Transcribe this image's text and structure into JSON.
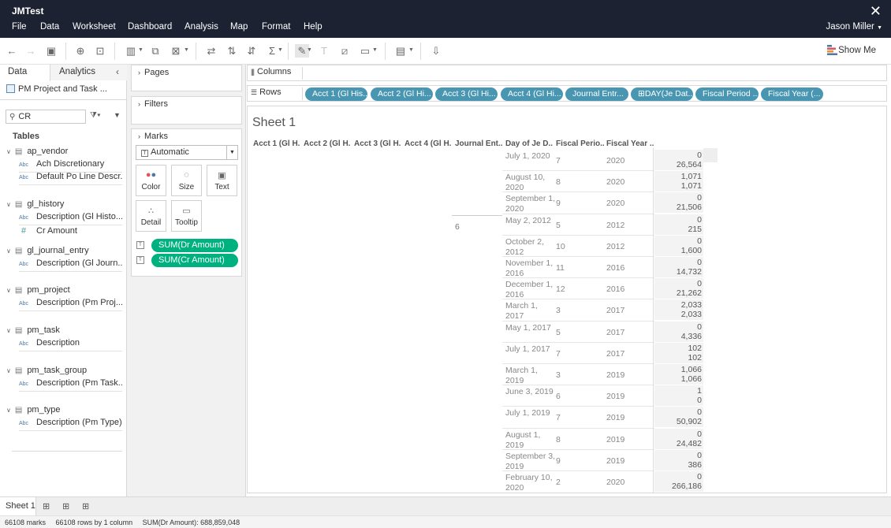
{
  "app": {
    "title": "JMTest",
    "user": "Jason Miller"
  },
  "menu": [
    "File",
    "Data",
    "Worksheet",
    "Dashboard",
    "Analysis",
    "Map",
    "Format",
    "Help"
  ],
  "toolbar": {
    "show_me": "Show Me"
  },
  "data_pane": {
    "tab_data": "Data",
    "tab_analytics": "Analytics",
    "datasource": "PM Project and Task ...",
    "search_value": "CR",
    "tables_header": "Tables",
    "tables": [
      {
        "name": "ap_vendor",
        "fields": [
          {
            "type": "Abc",
            "name": "Ach Discretionary"
          },
          {
            "type": "Abc",
            "name": "Default Po Line Descr..."
          }
        ]
      },
      {
        "name": "gl_history",
        "fields": [
          {
            "type": "Abc",
            "name": "Description (Gl Histo..."
          },
          {
            "type": "#",
            "name": "Cr Amount"
          }
        ]
      },
      {
        "name": "gl_journal_entry",
        "fields": [
          {
            "type": "Abc",
            "name": "Description (Gl Journ..."
          }
        ]
      },
      {
        "name": "pm_project",
        "fields": [
          {
            "type": "Abc",
            "name": "Description (Pm Proj..."
          }
        ]
      },
      {
        "name": "pm_task",
        "fields": [
          {
            "type": "Abc",
            "name": "Description"
          }
        ]
      },
      {
        "name": "pm_task_group",
        "fields": [
          {
            "type": "Abc",
            "name": "Description (Pm Task..."
          }
        ]
      },
      {
        "name": "pm_type",
        "fields": [
          {
            "type": "Abc",
            "name": "Description (Pm Type)"
          }
        ]
      }
    ]
  },
  "cards": {
    "pages": "Pages",
    "filters": "Filters",
    "marks": "Marks",
    "mark_type": "Automatic",
    "mark_buttons": [
      "Color",
      "Size",
      "Text",
      "Detail",
      "Tooltip"
    ],
    "mark_pills": [
      "SUM(Dr Amount)",
      "SUM(Cr Amount)"
    ]
  },
  "shelves": {
    "columns_label": "Columns",
    "rows_label": "Rows",
    "row_pills": [
      "Acct 1 (Gl His...",
      "Acct 2 (Gl Hi...",
      "Acct 3 (Gl Hi...",
      "Acct 4 (Gl Hi...",
      "Journal Entr...",
      "DAY(Je Dat...",
      "Fiscal Period ...",
      "Fiscal Year (..."
    ]
  },
  "sheet": {
    "title": "Sheet 1",
    "headers": [
      "Acct 1 (Gl H..",
      "Acct 2 (Gl H..",
      "Acct 3 (Gl H..",
      "Acct 4 (Gl H..",
      "Journal Ent..",
      "Day of Je D..",
      "Fiscal Perio..",
      "Fiscal Year .."
    ],
    "journal_entry": "6",
    "rows": [
      {
        "date": "July 1, 2020",
        "period": "7",
        "year": "2020",
        "dr": "0",
        "cr": "26,564"
      },
      {
        "date": "August 10, 2020",
        "period": "8",
        "year": "2020",
        "dr": "1,071",
        "cr": "1,071"
      },
      {
        "date": "September 1, 2020",
        "period": "9",
        "year": "2020",
        "dr": "0",
        "cr": "21,506"
      },
      {
        "date": "May 2, 2012",
        "period": "5",
        "year": "2012",
        "dr": "0",
        "cr": "215"
      },
      {
        "date": "October 2, 2012",
        "period": "10",
        "year": "2012",
        "dr": "0",
        "cr": "1,600"
      },
      {
        "date": "November 1, 2016",
        "period": "11",
        "year": "2016",
        "dr": "0",
        "cr": "14,732"
      },
      {
        "date": "December 1, 2016",
        "period": "12",
        "year": "2016",
        "dr": "0",
        "cr": "21,262"
      },
      {
        "date": "March 1, 2017",
        "period": "3",
        "year": "2017",
        "dr": "2,033",
        "cr": "2,033"
      },
      {
        "date": "May 1, 2017",
        "period": "5",
        "year": "2017",
        "dr": "0",
        "cr": "4,336"
      },
      {
        "date": "July 1, 2017",
        "period": "7",
        "year": "2017",
        "dr": "102",
        "cr": "102"
      },
      {
        "date": "March 1, 2019",
        "period": "3",
        "year": "2019",
        "dr": "1,066",
        "cr": "1,066"
      },
      {
        "date": "June 3, 2019",
        "period": "6",
        "year": "2019",
        "dr": "1",
        "cr": "0"
      },
      {
        "date": "July 1, 2019",
        "period": "7",
        "year": "2019",
        "dr": "0",
        "cr": "50,902"
      },
      {
        "date": "August 1, 2019",
        "period": "8",
        "year": "2019",
        "dr": "0",
        "cr": "24,482"
      },
      {
        "date": "September 3, 2019",
        "period": "9",
        "year": "2019",
        "dr": "0",
        "cr": "386"
      },
      {
        "date": "February 10, 2020",
        "period": "2",
        "year": "2020",
        "dr": "0",
        "cr": "266,186"
      }
    ]
  },
  "sheet_tabs": [
    "Sheet 1"
  ],
  "status": {
    "marks": "66108 marks",
    "rows": "66108 rows by 1 column",
    "sum": "SUM(Dr Amount): 688,859,048"
  }
}
